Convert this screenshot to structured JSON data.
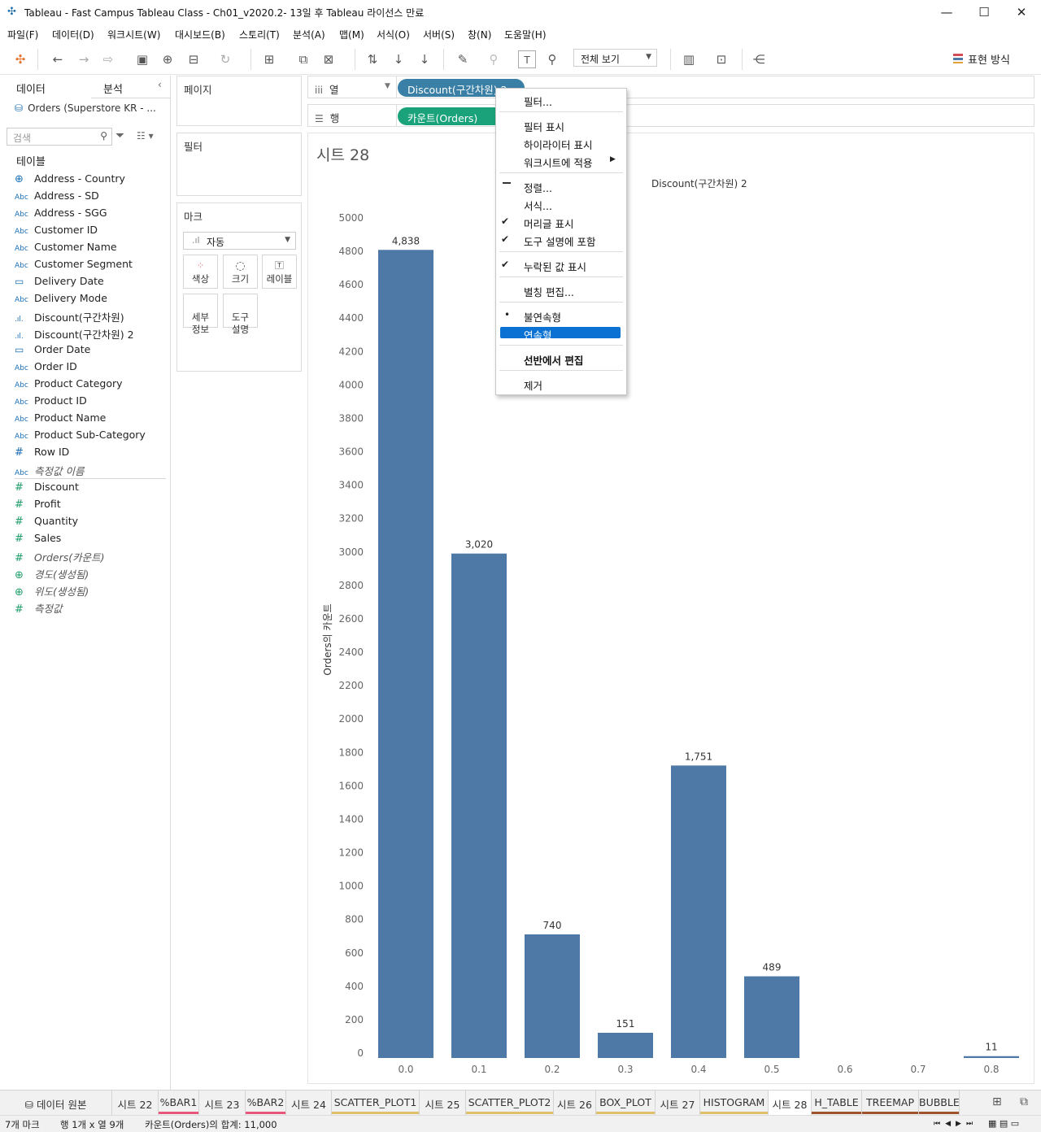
{
  "window": {
    "title": "Tableau - Fast Campus Tableau Class - Ch01_v2020.2- 13일 후 Tableau 라이선스 만료",
    "minimize": "—",
    "maximize": "☐",
    "close": "✕"
  },
  "menu": [
    "파일(F)",
    "데이터(D)",
    "워크시트(W)",
    "대시보드(B)",
    "스토리(T)",
    "분석(A)",
    "맵(M)",
    "서식(O)",
    "서버(S)",
    "창(N)",
    "도움말(H)"
  ],
  "toolbar": {
    "fit_label": "전체 보기",
    "show_me": "표현 방식"
  },
  "left_pane": {
    "tab_data": "데이터",
    "tab_analytics": "분석",
    "datasource": "Orders (Superstore KR - ...",
    "search_placeholder": "검색",
    "tables_header": "테이블",
    "dimensions": [
      {
        "icon": "globe-icon",
        "glyph": "⊕",
        "name": "Address - Country",
        "italic": false
      },
      {
        "icon": "abc-icon",
        "glyph": "Abc",
        "name": "Address - SD",
        "italic": false
      },
      {
        "icon": "abc-icon",
        "glyph": "Abc",
        "name": "Address - SGG",
        "italic": false
      },
      {
        "icon": "abc-icon",
        "glyph": "Abc",
        "name": "Customer ID",
        "italic": false
      },
      {
        "icon": "abc-icon",
        "glyph": "Abc",
        "name": "Customer Name",
        "italic": false
      },
      {
        "icon": "abc-icon",
        "glyph": "Abc",
        "name": "Customer Segment",
        "italic": false
      },
      {
        "icon": "calendar-icon",
        "glyph": "▭",
        "name": "Delivery Date",
        "italic": false
      },
      {
        "icon": "abc-icon",
        "glyph": "Abc",
        "name": "Delivery Mode",
        "italic": false
      },
      {
        "icon": "bin-icon",
        "glyph": ".ıl.",
        "name": "Discount(구간차원)",
        "italic": false
      },
      {
        "icon": "bin-icon",
        "glyph": ".ıl.",
        "name": "Discount(구간차원) 2",
        "italic": false
      },
      {
        "icon": "calendar-icon",
        "glyph": "▭",
        "name": "Order Date",
        "italic": false
      },
      {
        "icon": "abc-icon",
        "glyph": "Abc",
        "name": "Order ID",
        "italic": false
      },
      {
        "icon": "abc-icon",
        "glyph": "Abc",
        "name": "Product Category",
        "italic": false
      },
      {
        "icon": "abc-icon",
        "glyph": "Abc",
        "name": "Product ID",
        "italic": false
      },
      {
        "icon": "abc-icon",
        "glyph": "Abc",
        "name": "Product Name",
        "italic": false
      },
      {
        "icon": "abc-icon",
        "glyph": "Abc",
        "name": "Product Sub-Category",
        "italic": false
      },
      {
        "icon": "hash-icon",
        "glyph": "#",
        "name": "Row ID",
        "italic": false
      },
      {
        "icon": "abc-icon",
        "glyph": "Abc",
        "name": "측정값 이름",
        "italic": true
      }
    ],
    "measures": [
      {
        "icon": "hash-icon",
        "glyph": "#",
        "name": "Discount",
        "italic": false
      },
      {
        "icon": "hash-icon",
        "glyph": "#",
        "name": "Profit",
        "italic": false
      },
      {
        "icon": "hash-icon",
        "glyph": "#",
        "name": "Quantity",
        "italic": false
      },
      {
        "icon": "hash-icon",
        "glyph": "#",
        "name": "Sales",
        "italic": false
      },
      {
        "icon": "hash-icon",
        "glyph": "#",
        "name": "Orders(카운트)",
        "italic": true
      },
      {
        "icon": "globe-icon",
        "glyph": "⊕",
        "name": "경도(생성됨)",
        "italic": true
      },
      {
        "icon": "globe-icon",
        "glyph": "⊕",
        "name": "위도(생성됨)",
        "italic": true
      },
      {
        "icon": "hash-icon",
        "glyph": "#",
        "name": "측정값",
        "italic": true
      }
    ]
  },
  "cards": {
    "pages": "페이지",
    "filters": "필터",
    "marks": "마크",
    "mark_type": "자동",
    "mark_buttons": [
      {
        "name": "color",
        "label": "색상",
        "glyph": "●"
      },
      {
        "name": "size",
        "label": "크기",
        "glyph": "◌"
      },
      {
        "name": "label",
        "label": "레이블",
        "glyph": "T"
      },
      {
        "name": "detail",
        "label": "세부\n정보",
        "glyph": ""
      },
      {
        "name": "tooltip",
        "label": "도구\n설명",
        "glyph": ""
      }
    ]
  },
  "shelves": {
    "columns_label": "열",
    "rows_label": "행",
    "columns_pill": "Discount(구간차원) 2",
    "rows_pill": "카운트(Orders)"
  },
  "context_menu": {
    "items": [
      {
        "label": "필터...",
        "checked": false,
        "bullet": false,
        "bold": false
      },
      {
        "label": "필터 표시",
        "checked": false,
        "bullet": false,
        "bold": false
      },
      {
        "label": "하이라이터 표시",
        "checked": false,
        "bullet": false,
        "bold": false
      },
      {
        "label": "워크시트에 적용",
        "checked": false,
        "bullet": false,
        "bold": false,
        "submenu": true
      },
      {
        "label": "정렬...",
        "checked": false,
        "bullet": false,
        "bold": false
      },
      {
        "label": "서식...",
        "checked": false,
        "bullet": false,
        "bold": false
      },
      {
        "label": "머리글 표시",
        "checked": true,
        "bullet": false,
        "bold": false
      },
      {
        "label": "도구 설명에 포함",
        "checked": true,
        "bullet": false,
        "bold": false
      },
      {
        "label": "누락된 값 표시",
        "checked": true,
        "bullet": false,
        "bold": false
      },
      {
        "label": "별칭 편집...",
        "checked": false,
        "bullet": false,
        "bold": false
      },
      {
        "label": "불연속형",
        "checked": false,
        "bullet": true,
        "bold": false
      },
      {
        "label": "연속형",
        "checked": false,
        "bullet": false,
        "bold": false,
        "highlighted": true
      },
      {
        "label": "선반에서 편집",
        "checked": false,
        "bullet": false,
        "bold": true
      },
      {
        "label": "제거",
        "checked": false,
        "bullet": false,
        "bold": false
      }
    ]
  },
  "sheet": {
    "title": "시트 28"
  },
  "chart_data": {
    "type": "bar",
    "title": "",
    "column_header": "Discount(구간차원) 2",
    "ylabel": "Orders의 카운트",
    "xlabel": "",
    "categories": [
      "0.0",
      "0.1",
      "0.2",
      "0.3",
      "0.4",
      "0.5",
      "0.6",
      "0.7",
      "0.8"
    ],
    "values": [
      4838,
      3020,
      740,
      151,
      1751,
      489,
      0,
      0,
      11
    ],
    "data_labels": [
      "4,838",
      "3,020",
      "740",
      "151",
      "1,751",
      "489",
      "",
      "",
      "11"
    ],
    "ylim": [
      0,
      5000
    ],
    "yticks": [
      0,
      200,
      400,
      600,
      800,
      1000,
      1200,
      1400,
      1600,
      1800,
      2000,
      2200,
      2400,
      2600,
      2800,
      3000,
      3200,
      3400,
      3600,
      3800,
      4000,
      4200,
      4400,
      4600,
      4800,
      5000
    ],
    "bar_color": "#4e79a7",
    "grid": false
  },
  "sheet_tabs": [
    {
      "label": "데이터 원본",
      "underline": ""
    },
    {
      "label": "시트 22",
      "underline": ""
    },
    {
      "label": "%BAR1",
      "underline": "#e8567c"
    },
    {
      "label": "시트 23",
      "underline": ""
    },
    {
      "label": "%BAR2",
      "underline": "#e8567c"
    },
    {
      "label": "시트 24",
      "underline": ""
    },
    {
      "label": "SCATTER_PLOT1",
      "underline": "#e0c06a"
    },
    {
      "label": "시트 25",
      "underline": ""
    },
    {
      "label": "SCATTER_PLOT2",
      "underline": "#e0c06a"
    },
    {
      "label": "시트 26",
      "underline": ""
    },
    {
      "label": "BOX_PLOT",
      "underline": "#e0c06a"
    },
    {
      "label": "시트 27",
      "underline": ""
    },
    {
      "label": "HISTOGRAM",
      "underline": "#e0c06a"
    },
    {
      "label": "시트 28",
      "underline": "",
      "active": true
    },
    {
      "label": "H_TABLE",
      "underline": "#a0522d"
    },
    {
      "label": "TREEMAP",
      "underline": "#a0522d"
    },
    {
      "label": "BUBBLE",
      "underline": "#a0522d"
    }
  ],
  "status": {
    "marks": "7개 마크",
    "dims": "행 1개 x 열 9개",
    "sum": "카운트(Orders)의 합계: 11,000"
  }
}
